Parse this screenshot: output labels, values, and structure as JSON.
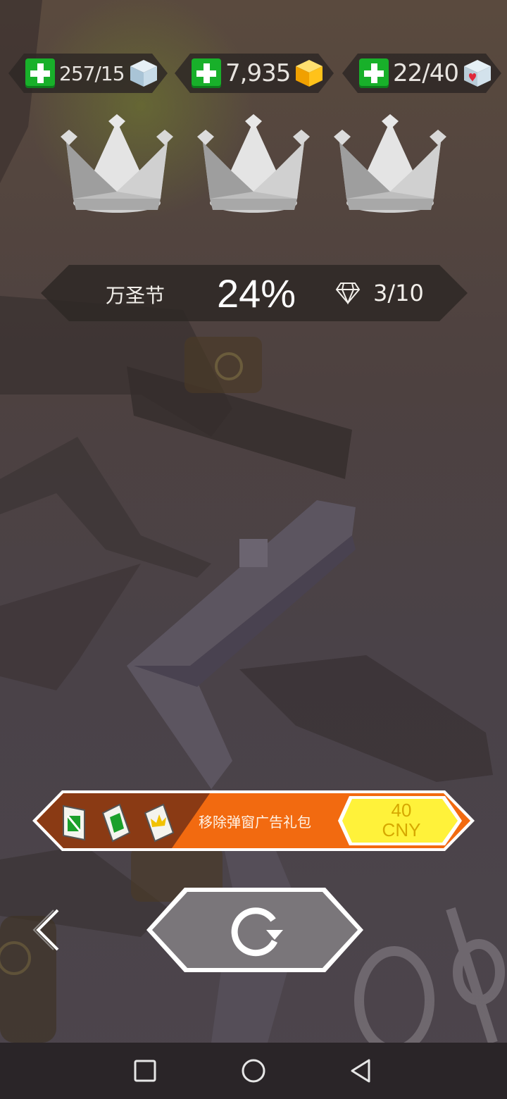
{
  "resources": {
    "items": [
      {
        "value": "257/15",
        "icon": "ice-cube-icon"
      },
      {
        "value": "7,935",
        "icon": "gold-cube-icon"
      },
      {
        "value": "22/40",
        "icon": "heart-cube-icon"
      }
    ]
  },
  "crowns": {
    "earned_count": 0,
    "total": 3
  },
  "level": {
    "name": "万圣节",
    "progress": "24%",
    "gems": "3/10"
  },
  "offer": {
    "title": "移除弹窗广告礼包",
    "price_amount": "40",
    "price_currency": "CNY",
    "cards": [
      "no-ads-card-icon",
      "bell-on-card-icon",
      "crown-card-icon"
    ]
  },
  "controls": {
    "back_icon": "chevron-left-icon",
    "retry_icon": "retry-icon"
  },
  "nav": {
    "recent_icon": "square-icon",
    "home_icon": "circle-icon",
    "back_icon": "triangle-back-icon"
  },
  "colors": {
    "plus_green": "#18b02a",
    "ad_orange": "#f26a10",
    "ad_brown": "#8a3a14",
    "price_yellow": "#fff23a",
    "pill_dark": "#2e2826"
  }
}
